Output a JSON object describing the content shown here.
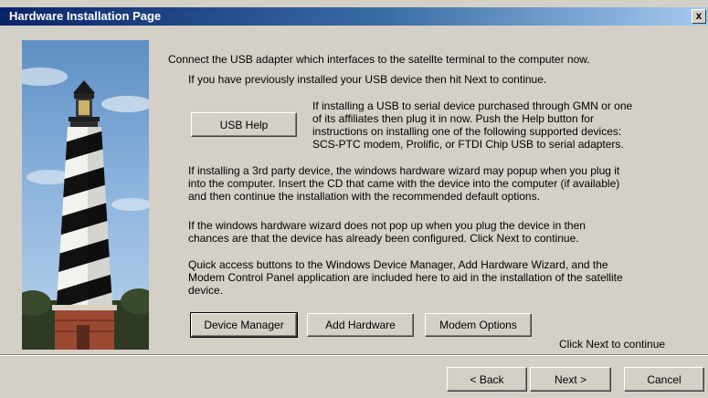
{
  "window": {
    "title": "Hardware Installation Page",
    "close_label": "x"
  },
  "content": {
    "intro": "Connect the USB adapter which interfaces to the satellte terminal to the computer now.",
    "previously_installed": "If you have previously installed your USB device then hit Next to continue.",
    "gmn_info_lines": [
      "If installing a USB to serial device purchased through GMN or one",
      "of its affiliates then plug it in now.  Push the Help button for",
      "instructions on installing one of the following supported devices:",
      "SCS-PTC modem,  Prolific, or FTDI Chip USB to serial adapters."
    ],
    "third_party_lines": [
      "If installing a 3rd party device, the windows hardware wizard may popup when you plug it",
      "into the computer. Insert the CD that came with the device into the computer (if available)",
      "and then continue the installation with the recommended default options."
    ],
    "no_popup_lines": [
      "If the windows hardware wizard does not pop up when you plug the device in then",
      "chances are that the device has already been configured. Click Next to continue."
    ],
    "quick_access_lines": [
      "Quick access buttons to the Windows Device Manager, Add Hardware Wizard, and the",
      "Modem Control Panel application are included here to aid in the installation of the satellite",
      "device."
    ],
    "click_next": "Click Next to continue"
  },
  "buttons": {
    "usb_help": "USB Help",
    "device_manager": "Device Manager",
    "add_hardware": "Add Hardware",
    "modem_options": "Modem Options",
    "back": "< Back",
    "next": "Next >",
    "cancel": "Cancel"
  },
  "colors": {
    "dialog_bg": "#d4d0c8",
    "title_start": "#0a246a",
    "title_end": "#a6caf0"
  },
  "icons": {
    "close": "close-icon",
    "lighthouse": "lighthouse-image"
  }
}
